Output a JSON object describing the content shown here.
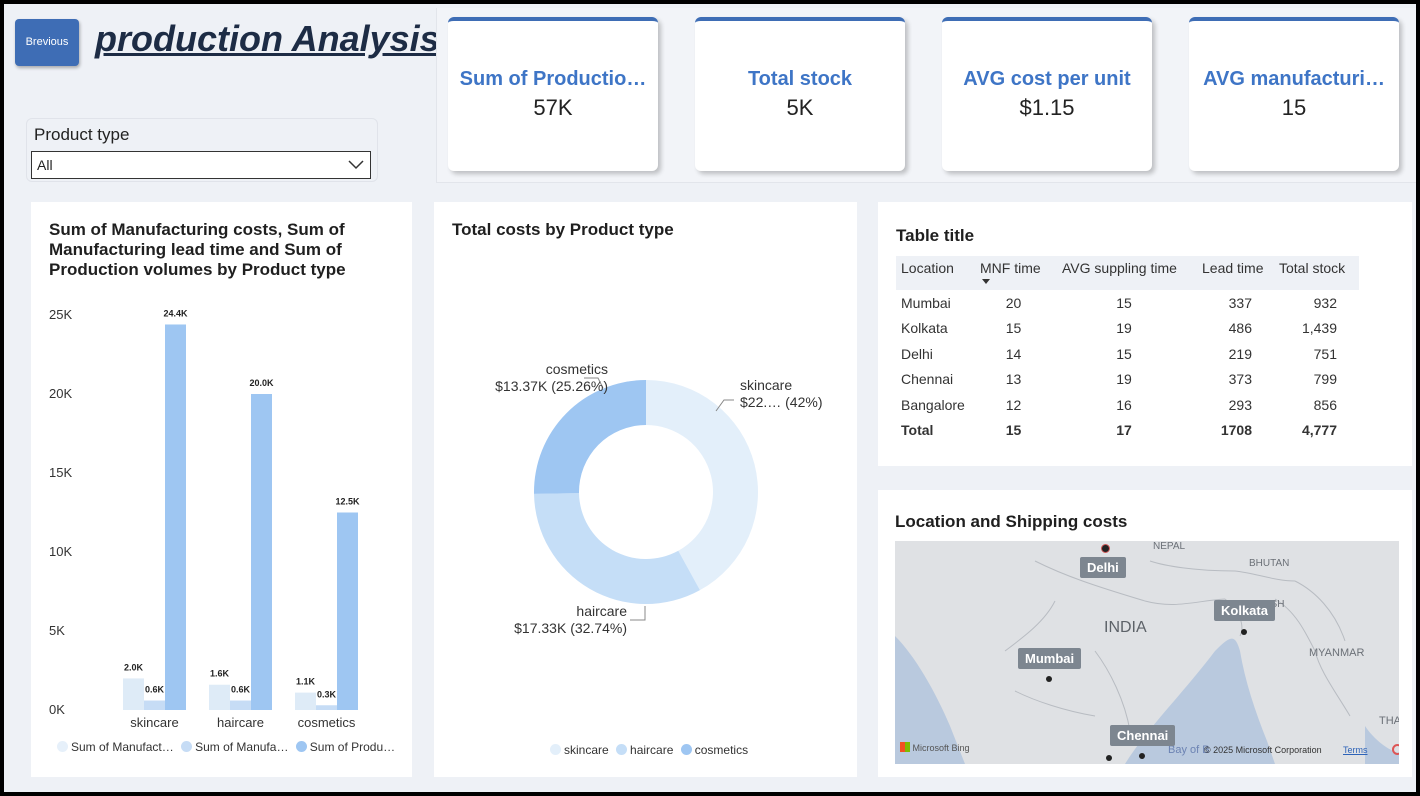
{
  "header": {
    "back_button": "Brevious",
    "title": "production Analysis"
  },
  "filter": {
    "label": "Product type",
    "selected": "All"
  },
  "kpis": [
    {
      "title": "Sum of Productio…",
      "value": "57K"
    },
    {
      "title": "Total stock",
      "value": "5K"
    },
    {
      "title": "AVG cost per unit",
      "value": "$1.15"
    },
    {
      "title": "AVG manufacturi…",
      "value": "15"
    }
  ],
  "bar_card": {
    "title_lines": [
      "Sum of Manufacturing costs, Sum of",
      "Manufacturing lead time and Sum of",
      "Production volumes by Product type"
    ],
    "legend": [
      "Sum of Manufact…",
      "Sum of Manufa…",
      "Sum of Produ…"
    ]
  },
  "donut_card": {
    "title": "Total costs by Product type",
    "labels": [
      {
        "name": "skincare",
        "value": "$22.… (42%)"
      },
      {
        "name": "cosmetics",
        "value": "$13.37K (25.26%)"
      },
      {
        "name": "haircare",
        "value": "$17.33K (32.74%)"
      }
    ],
    "legend": [
      "skincare",
      "haircare",
      "cosmetics"
    ]
  },
  "table_card": {
    "title": "Table title",
    "columns": [
      "Location",
      "MNF time",
      "AVG suppling time",
      "Lead time",
      "Total stock"
    ],
    "rows": [
      [
        "Mumbai",
        "20",
        "15",
        "337",
        "932"
      ],
      [
        "Kolkata",
        "15",
        "19",
        "486",
        "1,439"
      ],
      [
        "Delhi",
        "14",
        "15",
        "219",
        "751"
      ],
      [
        "Chennai",
        "13",
        "19",
        "373",
        "799"
      ],
      [
        "Bangalore",
        "12",
        "16",
        "293",
        "856"
      ]
    ],
    "total": [
      "Total",
      "15",
      "17",
      "1708",
      "4,777"
    ]
  },
  "map_card": {
    "title": "Location and Shipping costs",
    "cities": [
      "Delhi",
      "Kolkata",
      "Mumbai",
      "Chennai"
    ],
    "regions": [
      "NEPAL",
      "BHUTAN",
      "ADESH",
      "INDIA",
      "MYANMAR",
      "THA",
      "Bay of B"
    ],
    "provider": "Microsoft Bing",
    "copyright": "© 2025 Microsoft Corporation",
    "terms": "Terms"
  },
  "colors": {
    "accent": "#3e6db5",
    "kpi_title": "#3e75c6",
    "series_light": "#deebf7",
    "series_mid": "#c6dcf5",
    "series_dark": "#9ec6f2",
    "skincare": "#e3effa",
    "haircare": "#c5def7",
    "cosmetics": "#9ec6f2"
  },
  "chart_data": [
    {
      "type": "bar",
      "categories": [
        "skincare",
        "haircare",
        "cosmetics"
      ],
      "series": [
        {
          "name": "Sum of Manufact…",
          "values": [
            2.0,
            1.6,
            1.1
          ],
          "labels": [
            "2.0K",
            "1.6K",
            "1.1K"
          ]
        },
        {
          "name": "Sum of Manufa…",
          "values": [
            0.6,
            0.6,
            0.3
          ],
          "labels": [
            "0.6K",
            "0.6K",
            "0.3K"
          ]
        },
        {
          "name": "Sum of Produ…",
          "values": [
            24.4,
            20.0,
            12.5
          ],
          "labels": [
            "24.4K",
            "20.0K",
            "12.5K"
          ]
        }
      ],
      "yticks": [
        "0K",
        "5K",
        "10K",
        "15K",
        "20K",
        "25K"
      ],
      "ylim": [
        0,
        25
      ],
      "grid": false,
      "legend": "bottom"
    },
    {
      "type": "pie",
      "donut": true,
      "categories": [
        "skincare",
        "haircare",
        "cosmetics"
      ],
      "values": [
        42.0,
        32.74,
        25.26
      ],
      "legend": "bottom"
    }
  ]
}
